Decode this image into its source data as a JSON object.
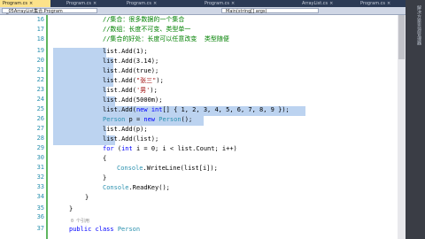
{
  "tabs": [
    {
      "label": "Program.cs",
      "active": true
    },
    {
      "label": "Program.cs",
      "active": false
    },
    {
      "label": "Program.cs",
      "active": false
    },
    {
      "label": "Program.cs",
      "active": false
    },
    {
      "label": "ArrayList.cs",
      "active": false
    },
    {
      "label": "Program.cs",
      "active": false
    }
  ],
  "navbar": {
    "class_dropdown": "_05ArrayList集合.Program",
    "member_dropdown": "Main(string[] args)"
  },
  "line_numbers": [
    "16",
    "17",
    "18",
    "19",
    "20",
    "21",
    "22",
    "23",
    "24",
    "25",
    "26",
    "27",
    "28",
    "29",
    "30",
    "31",
    "32",
    "33",
    "34",
    "35",
    "36",
    "37"
  ],
  "code": {
    "l16": "//集合：很多数据的一个集合",
    "l17": "//数组：长度不可变、类型单一",
    "l18": "//集合的好处：长度可以任意改变  类型随便",
    "l19": "list.Add(1);",
    "l20": "list.Add(3.14);",
    "l21": "list.Add(true);",
    "l22a": "list.Add(",
    "l22b": "\"张三\"",
    "l22c": ");",
    "l23a": "list.Add(",
    "l23b": "'男'",
    "l23c": ");",
    "l24": "list.Add(5000m);",
    "l25a": "list.Add(",
    "l25b": "new",
    "l25c": " ",
    "l25d": "int",
    "l25e": "[] { 1, 2, 3, 4, 5, 6, 7, 8, 9 });",
    "l26a": "Person",
    "l26b": " p = ",
    "l26c": "new",
    "l26d": " ",
    "l26e": "Person",
    "l26f": "();",
    "l27": "list.Add(p);",
    "l28": "list.Add(list);",
    "l29a": "for",
    "l29b": " (",
    "l29c": "int",
    "l29d": " i = 0; i < list.Count; i++)",
    "l30": "{",
    "l31a": "Console",
    "l31b": ".WriteLine(list[i]);",
    "l32": "}",
    "l33a": "Console",
    "l33b": ".ReadKey();",
    "l34": "}",
    "l35": "}",
    "l36": "",
    "l37a": "public",
    "l37b": " ",
    "l37c": "class",
    "l37d": " ",
    "l37e": "Person",
    "ref": "0 个引用"
  },
  "right_panel": "解决方案资源管理器"
}
